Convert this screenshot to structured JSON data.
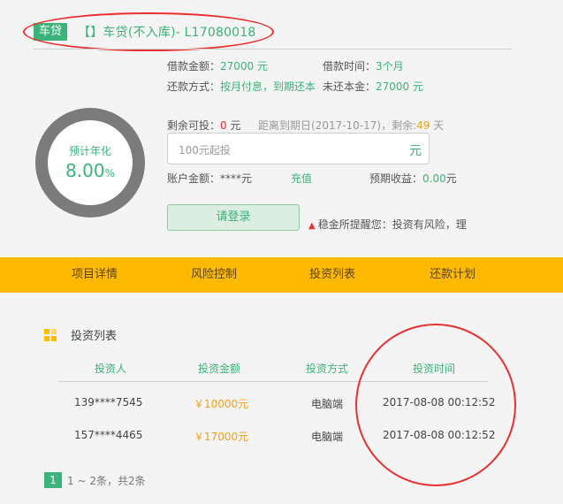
{
  "header": {
    "tag": "车贷",
    "title": "【】车贷(不入库)- L17080018"
  },
  "loan": {
    "amount_label": "借款金额：",
    "amount_value": "27000 元",
    "term_label": "借款时间：",
    "term_value": "3个月",
    "repay_label": "还款方式：",
    "repay_value": "按月付息，到期还本",
    "outstanding_label": "未还本金：",
    "outstanding_value": "27000 元"
  },
  "rate": {
    "label": "预计年化",
    "value": "8.00",
    "unit": "%"
  },
  "invest": {
    "remain_label": "剩余可投：",
    "remain_value": "0",
    "remain_unit": "元",
    "expire_text": "距离到期日(2017-10-17)，剩余:",
    "days_left": "49",
    "days_unit": "天",
    "placeholder": "100元起投",
    "input_unit": "元",
    "balance_label": "账户金额：",
    "balance_value": "****元",
    "recharge": "充值",
    "expected_label": "预期收益：",
    "expected_value": "0.00",
    "expected_unit": "元",
    "login_button": "请登录",
    "warning": "稳金所提醒您：投资有风险，理"
  },
  "tabs": [
    "项目详情",
    "风险控制",
    "投资列表",
    "还款计划"
  ],
  "invest_list": {
    "title": "投资列表",
    "headers": [
      "投资人",
      "投资金额",
      "投资方式",
      "投资时间"
    ],
    "rows": [
      [
        "139****7545",
        "￥10000元",
        "电脑端",
        "2017-08-08 00:12:52"
      ],
      [
        "157****4465",
        "￥17000元",
        "电脑端",
        "2017-08-08 00:12:52"
      ]
    ]
  },
  "pagination": {
    "current": "1",
    "summary": "1 ~ 2条，共2条"
  },
  "colors": {
    "accent_green": "#3cb37a",
    "tab_bar": "#ffb900",
    "annotation_red": "#e8302e"
  }
}
